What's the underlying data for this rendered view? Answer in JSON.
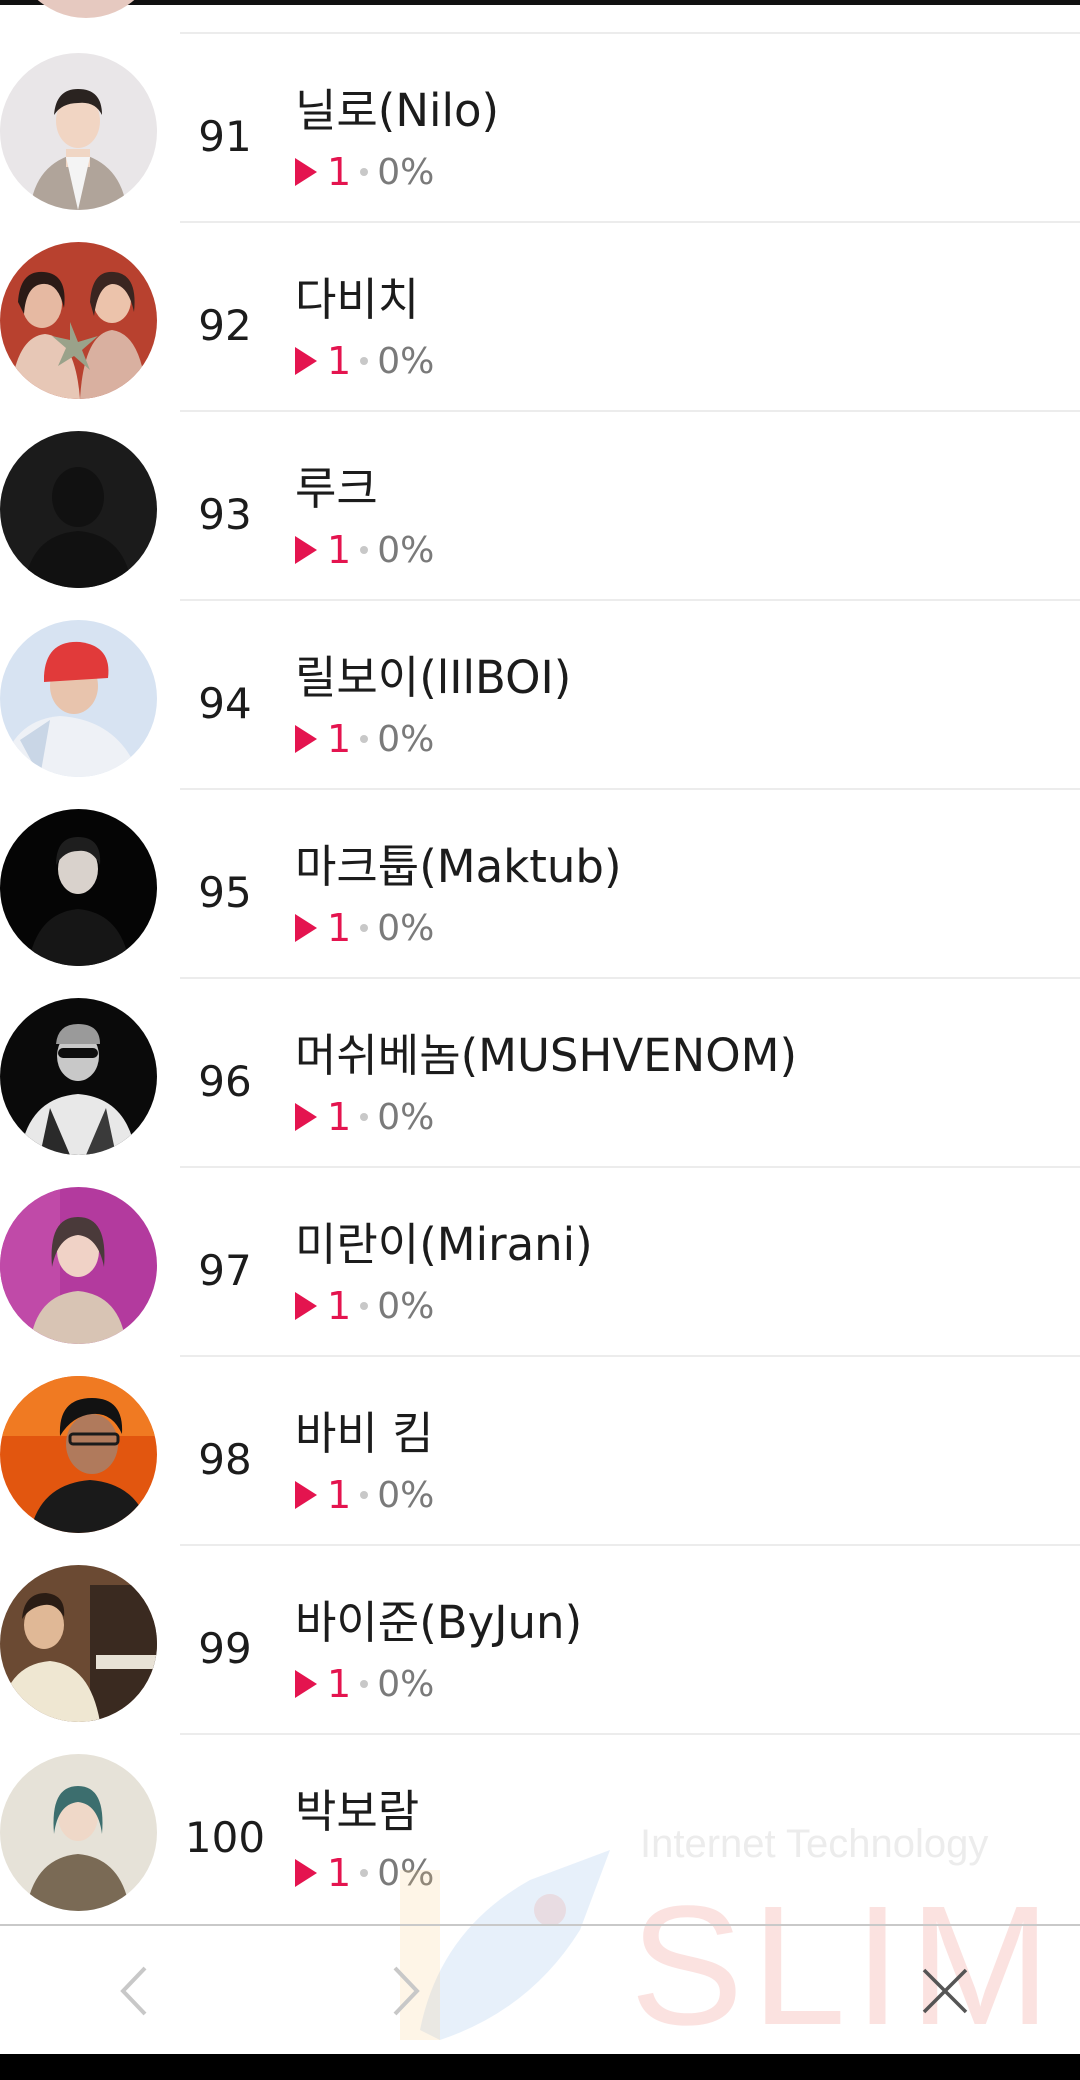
{
  "chart": {
    "rows": [
      {
        "rank": "91",
        "artist": "닐로(Nilo)",
        "plays": "1",
        "percent": "0%",
        "avatar": "person-light-bg"
      },
      {
        "rank": "92",
        "artist": "다비치",
        "plays": "1",
        "percent": "0%",
        "avatar": "duo-red-bg"
      },
      {
        "rank": "93",
        "artist": "루크",
        "plays": "1",
        "percent": "0%",
        "avatar": "default-silhouette"
      },
      {
        "rank": "94",
        "artist": "릴보이(lIlBOI)",
        "plays": "1",
        "percent": "0%",
        "avatar": "person-red-beanie"
      },
      {
        "rank": "95",
        "artist": "마크툽(Maktub)",
        "plays": "1",
        "percent": "0%",
        "avatar": "person-black-bg"
      },
      {
        "rank": "96",
        "artist": "머쉬베놈(MUSHVENOM)",
        "plays": "1",
        "percent": "0%",
        "avatar": "person-sunglasses-bw"
      },
      {
        "rank": "97",
        "artist": "미란이(Mirani)",
        "plays": "1",
        "percent": "0%",
        "avatar": "person-purple-bg"
      },
      {
        "rank": "98",
        "artist": "바비 킴",
        "plays": "1",
        "percent": "0%",
        "avatar": "person-orange-bg"
      },
      {
        "rank": "99",
        "artist": "바이준(ByJun)",
        "plays": "1",
        "percent": "0%",
        "avatar": "person-piano"
      },
      {
        "rank": "100",
        "artist": "박보람",
        "plays": "1",
        "percent": "0%",
        "avatar": "person-beige-bg"
      }
    ]
  },
  "watermark": {
    "line1": "Internet Technology",
    "line2": "SLIM"
  },
  "nav": {
    "back_icon": "chevron-left-icon",
    "forward_icon": "chevron-right-icon",
    "close_icon": "close-icon"
  },
  "colors": {
    "accent": "#e4144f",
    "divider": "#ececec"
  }
}
